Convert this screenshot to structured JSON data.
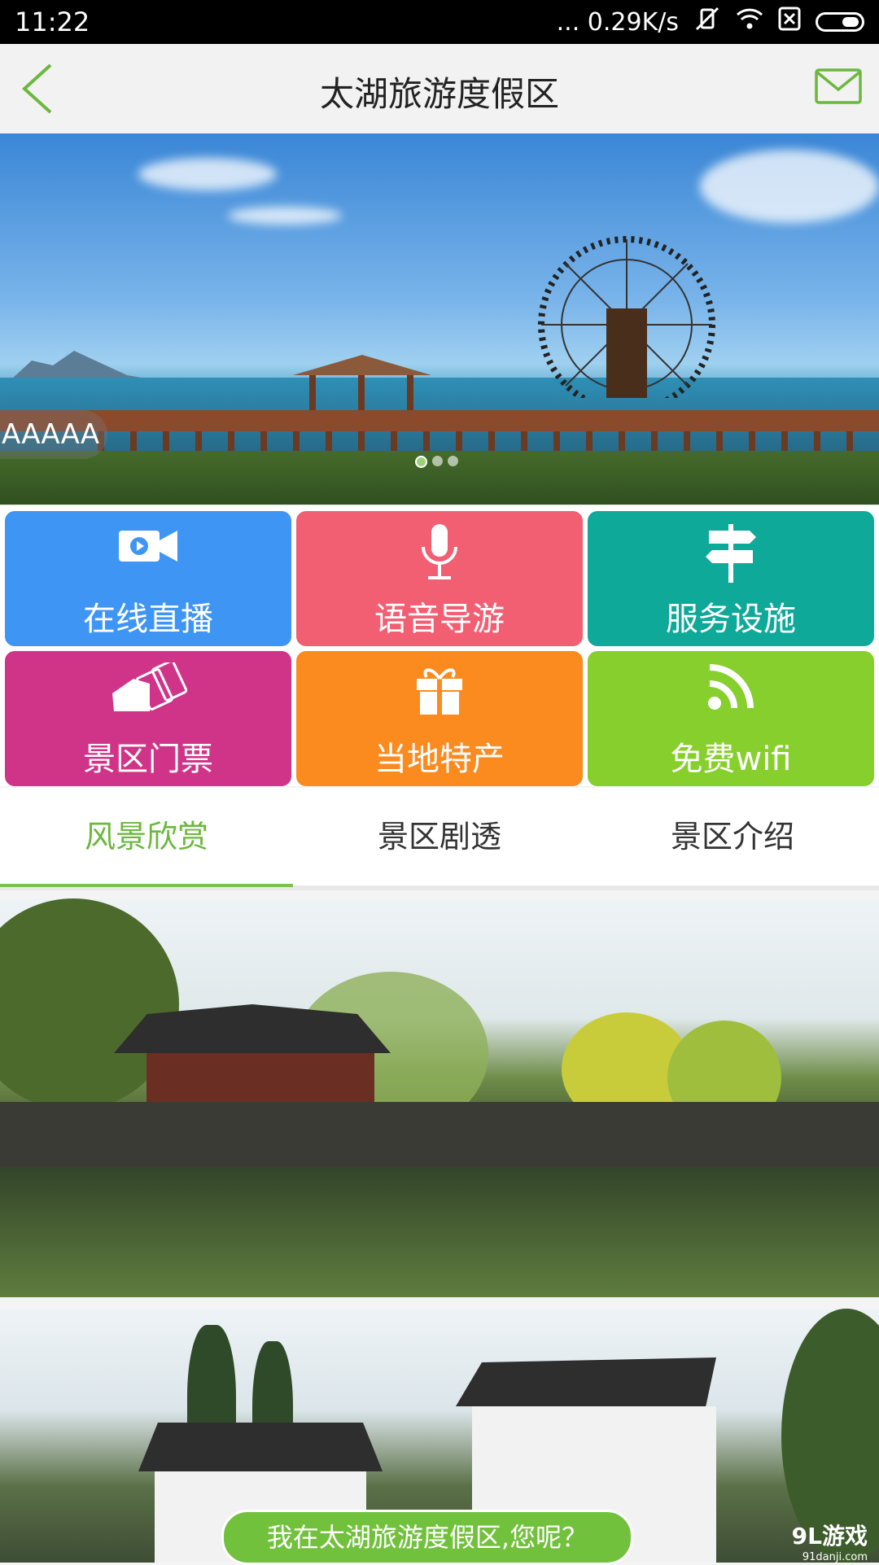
{
  "status_bar": {
    "time": "11:22",
    "network_speed": "... 0.29K/s",
    "icons": [
      "vibrate-off-icon",
      "wifi-icon",
      "sim-card-icon",
      "battery-icon"
    ]
  },
  "header": {
    "title": "太湖旅游度假区",
    "back_icon": "chevron-left-icon",
    "mail_icon": "mail-icon"
  },
  "banner": {
    "caption": "AAAAA",
    "slides": 3,
    "active_slide": 1
  },
  "features": [
    {
      "label": "在线直播",
      "icon": "video-camera-icon",
      "color": "#3f95f3"
    },
    {
      "label": "语音导游",
      "icon": "microphone-icon",
      "color": "#f25f73"
    },
    {
      "label": "服务设施",
      "icon": "signpost-icon",
      "color": "#0fa999"
    },
    {
      "label": "景区门票",
      "icon": "tickets-icon",
      "color": "#d03488"
    },
    {
      "label": "当地特产",
      "icon": "gift-icon",
      "color": "#fb8a1f"
    },
    {
      "label": "免费wifi",
      "icon": "rss-wifi-icon",
      "color": "#86cf2c"
    }
  ],
  "tabs": [
    {
      "label": "风景欣赏",
      "active": true
    },
    {
      "label": "景区剧透",
      "active": false
    },
    {
      "label": "景区介绍",
      "active": false
    }
  ],
  "accent_color": "#6bb83c",
  "bottom_banner": "我在太湖旅游度假区,您呢？",
  "watermark": {
    "brand": "9L游戏",
    "site": "91danji.com"
  }
}
